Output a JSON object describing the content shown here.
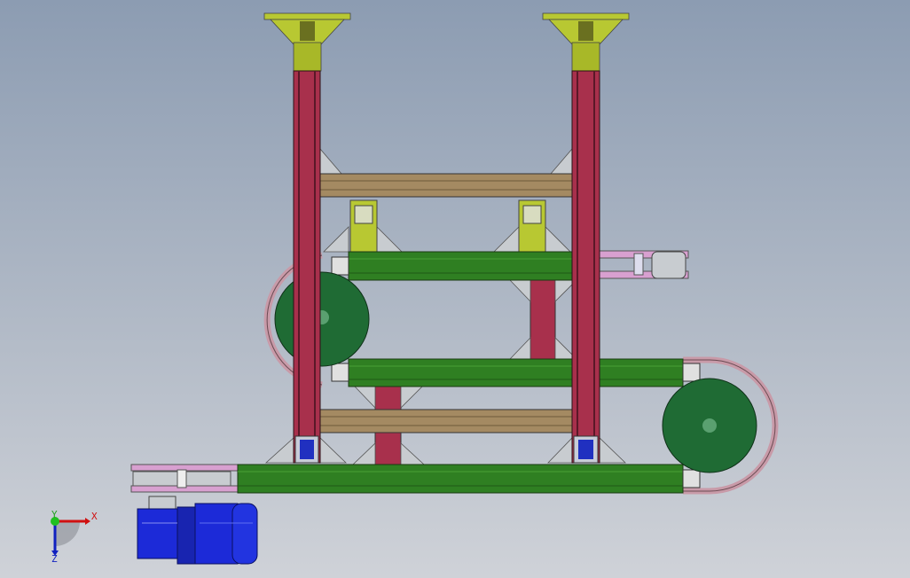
{
  "viewport": {
    "triad": {
      "x_label": "X",
      "y_label": "Y",
      "z_label": "Z"
    },
    "colors": {
      "mount": "#b8c832",
      "column": "#a8304c",
      "beam_green": "#2f7f22",
      "beam_tan": "#a48a62",
      "wheel": "#1f6b34",
      "belt": "#c89aa8",
      "motor": "#1c2ad8"
    }
  }
}
